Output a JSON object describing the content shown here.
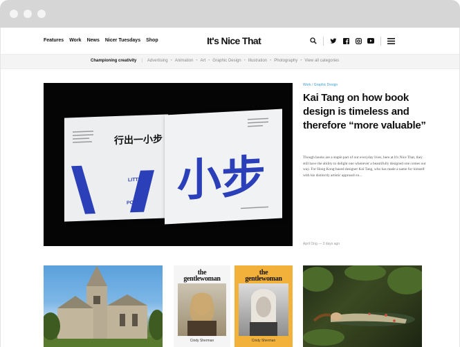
{
  "site": {
    "logo": "It's Nice That"
  },
  "nav": {
    "items": [
      "Features",
      "Work",
      "News",
      "Nicer Tuesdays",
      "Shop"
    ]
  },
  "header_icons": [
    "search-icon",
    "twitter-icon",
    "facebook-icon",
    "instagram-icon",
    "youtube-icon",
    "menu-icon"
  ],
  "categories": {
    "lead": "Championing creativity",
    "items": [
      "Advertising",
      "Animation",
      "Art",
      "Graphic Design",
      "Illustration",
      "Photography",
      "View all categories"
    ]
  },
  "hero": {
    "section": "Work",
    "tag": "Graphic Design",
    "title": "Kai Tang on how book design is timeless and therefore “more valuable”",
    "excerpt": "Though books are a staple part of our everyday lives, here at It's Nice That, they still have the ability to delight one whenever a beautifully designed one comes our way. For Hong Kong-based designer Kai Tang, who has made a name for himself with his distinctly artistic approach to...",
    "meta": "April Ong — 3 days ago",
    "book_text": {
      "cover_cjk": "小步",
      "left_cjk": "行出一小步",
      "little": "LITTLE",
      "post": "POST"
    }
  },
  "tiles": [
    {
      "name": "church-tile"
    },
    {
      "name": "gentlewoman-tile-1",
      "wordmark_line1": "the",
      "wordmark_line2": "gentlewoman",
      "caption": "Cindy Sherman"
    },
    {
      "name": "gentlewoman-tile-2",
      "wordmark_line1": "the",
      "wordmark_line2": "gentlewoman",
      "caption": "Cindy Sherman"
    },
    {
      "name": "painting-tile"
    }
  ],
  "colors": {
    "accent_link": "#3aa0d8",
    "cover_blue": "#2a3fb8",
    "gentlewoman_yellow": "#f2b13b",
    "hero_bg": "#050505"
  }
}
